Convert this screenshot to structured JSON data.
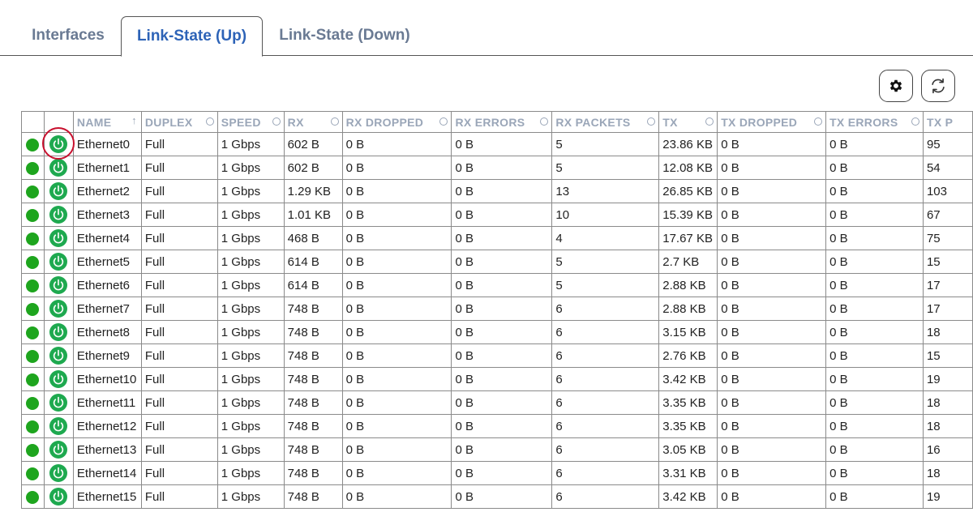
{
  "tabs": [
    {
      "label": "Interfaces"
    },
    {
      "label": "Link-State (Up)"
    },
    {
      "label": "Link-State (Down)"
    }
  ],
  "toolbar": {
    "settings_icon": "gear-icon",
    "refresh_icon": "refresh-icon"
  },
  "colors": {
    "active_tab": "#2d63b7",
    "status_green": "#1ea51e",
    "power_green": "#1ea94f",
    "highlight": "#c8102e"
  },
  "columns": [
    "NAME",
    "DUPLEX",
    "SPEED",
    "RX",
    "RX DROPPED",
    "RX ERRORS",
    "RX PACKETS",
    "TX",
    "TX DROPPED",
    "TX ERRORS",
    "TX P"
  ],
  "sort": {
    "column": "NAME",
    "direction": "ascending"
  },
  "rows": [
    {
      "name": "Ethernet0",
      "duplex": "Full",
      "speed": "1 Gbps",
      "rx": "602 B",
      "rx_dropped": "0 B",
      "rx_errors": "0 B",
      "rx_packets": "5",
      "tx": "23.86 KB",
      "tx_dropped": "0 B",
      "tx_errors": "0 B",
      "tx_packets": "95"
    },
    {
      "name": "Ethernet1",
      "duplex": "Full",
      "speed": "1 Gbps",
      "rx": "602 B",
      "rx_dropped": "0 B",
      "rx_errors": "0 B",
      "rx_packets": "5",
      "tx": "12.08 KB",
      "tx_dropped": "0 B",
      "tx_errors": "0 B",
      "tx_packets": "54"
    },
    {
      "name": "Ethernet2",
      "duplex": "Full",
      "speed": "1 Gbps",
      "rx": "1.29 KB",
      "rx_dropped": "0 B",
      "rx_errors": "0 B",
      "rx_packets": "13",
      "tx": "26.85 KB",
      "tx_dropped": "0 B",
      "tx_errors": "0 B",
      "tx_packets": "103"
    },
    {
      "name": "Ethernet3",
      "duplex": "Full",
      "speed": "1 Gbps",
      "rx": "1.01 KB",
      "rx_dropped": "0 B",
      "rx_errors": "0 B",
      "rx_packets": "10",
      "tx": "15.39 KB",
      "tx_dropped": "0 B",
      "tx_errors": "0 B",
      "tx_packets": "67"
    },
    {
      "name": "Ethernet4",
      "duplex": "Full",
      "speed": "1 Gbps",
      "rx": "468 B",
      "rx_dropped": "0 B",
      "rx_errors": "0 B",
      "rx_packets": "4",
      "tx": "17.67 KB",
      "tx_dropped": "0 B",
      "tx_errors": "0 B",
      "tx_packets": "75"
    },
    {
      "name": "Ethernet5",
      "duplex": "Full",
      "speed": "1 Gbps",
      "rx": "614 B",
      "rx_dropped": "0 B",
      "rx_errors": "0 B",
      "rx_packets": "5",
      "tx": "2.7 KB",
      "tx_dropped": "0 B",
      "tx_errors": "0 B",
      "tx_packets": "15"
    },
    {
      "name": "Ethernet6",
      "duplex": "Full",
      "speed": "1 Gbps",
      "rx": "614 B",
      "rx_dropped": "0 B",
      "rx_errors": "0 B",
      "rx_packets": "5",
      "tx": "2.88 KB",
      "tx_dropped": "0 B",
      "tx_errors": "0 B",
      "tx_packets": "17"
    },
    {
      "name": "Ethernet7",
      "duplex": "Full",
      "speed": "1 Gbps",
      "rx": "748 B",
      "rx_dropped": "0 B",
      "rx_errors": "0 B",
      "rx_packets": "6",
      "tx": "2.88 KB",
      "tx_dropped": "0 B",
      "tx_errors": "0 B",
      "tx_packets": "17"
    },
    {
      "name": "Ethernet8",
      "duplex": "Full",
      "speed": "1 Gbps",
      "rx": "748 B",
      "rx_dropped": "0 B",
      "rx_errors": "0 B",
      "rx_packets": "6",
      "tx": "3.15 KB",
      "tx_dropped": "0 B",
      "tx_errors": "0 B",
      "tx_packets": "18"
    },
    {
      "name": "Ethernet9",
      "duplex": "Full",
      "speed": "1 Gbps",
      "rx": "748 B",
      "rx_dropped": "0 B",
      "rx_errors": "0 B",
      "rx_packets": "6",
      "tx": "2.76 KB",
      "tx_dropped": "0 B",
      "tx_errors": "0 B",
      "tx_packets": "15"
    },
    {
      "name": "Ethernet10",
      "duplex": "Full",
      "speed": "1 Gbps",
      "rx": "748 B",
      "rx_dropped": "0 B",
      "rx_errors": "0 B",
      "rx_packets": "6",
      "tx": "3.42 KB",
      "tx_dropped": "0 B",
      "tx_errors": "0 B",
      "tx_packets": "19"
    },
    {
      "name": "Ethernet11",
      "duplex": "Full",
      "speed": "1 Gbps",
      "rx": "748 B",
      "rx_dropped": "0 B",
      "rx_errors": "0 B",
      "rx_packets": "6",
      "tx": "3.35 KB",
      "tx_dropped": "0 B",
      "tx_errors": "0 B",
      "tx_packets": "18"
    },
    {
      "name": "Ethernet12",
      "duplex": "Full",
      "speed": "1 Gbps",
      "rx": "748 B",
      "rx_dropped": "0 B",
      "rx_errors": "0 B",
      "rx_packets": "6",
      "tx": "3.35 KB",
      "tx_dropped": "0 B",
      "tx_errors": "0 B",
      "tx_packets": "18"
    },
    {
      "name": "Ethernet13",
      "duplex": "Full",
      "speed": "1 Gbps",
      "rx": "748 B",
      "rx_dropped": "0 B",
      "rx_errors": "0 B",
      "rx_packets": "6",
      "tx": "3.05 KB",
      "tx_dropped": "0 B",
      "tx_errors": "0 B",
      "tx_packets": "16"
    },
    {
      "name": "Ethernet14",
      "duplex": "Full",
      "speed": "1 Gbps",
      "rx": "748 B",
      "rx_dropped": "0 B",
      "rx_errors": "0 B",
      "rx_packets": "6",
      "tx": "3.31 KB",
      "tx_dropped": "0 B",
      "tx_errors": "0 B",
      "tx_packets": "18"
    },
    {
      "name": "Ethernet15",
      "duplex": "Full",
      "speed": "1 Gbps",
      "rx": "748 B",
      "rx_dropped": "0 B",
      "rx_errors": "0 B",
      "rx_packets": "6",
      "tx": "3.42 KB",
      "tx_dropped": "0 B",
      "tx_errors": "0 B",
      "tx_packets": "19"
    }
  ]
}
